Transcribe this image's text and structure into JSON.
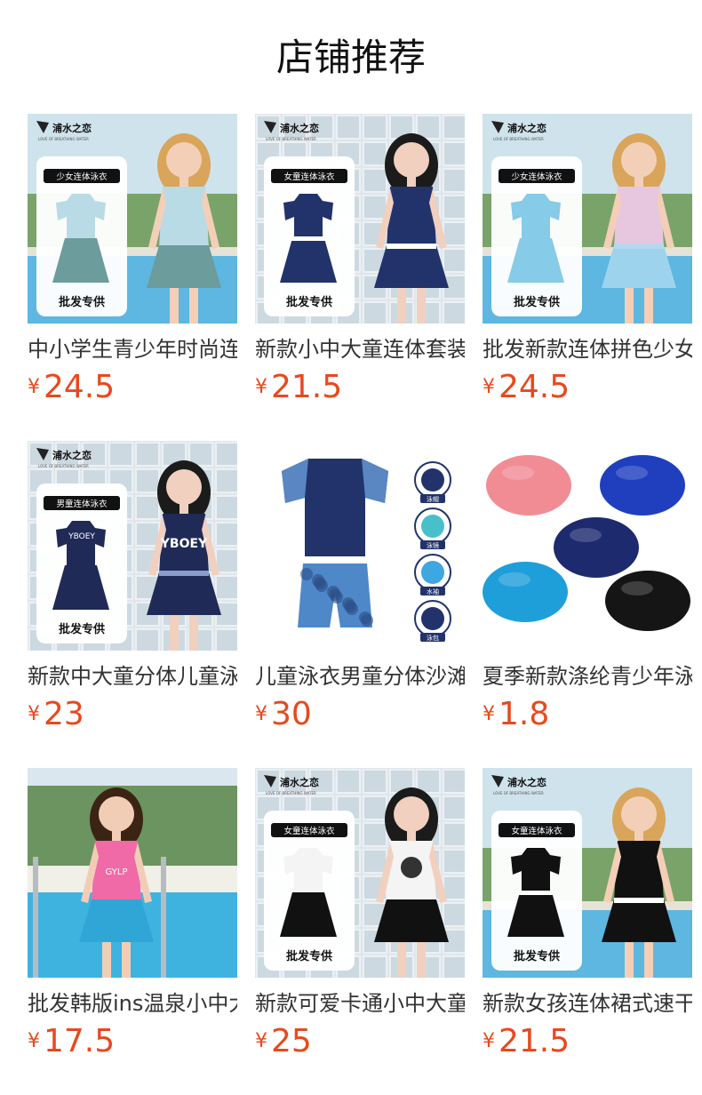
{
  "section_title": "店铺推荐",
  "currency": "¥",
  "badge": {
    "brand": "浦水之恋",
    "brand_sub": "LOVE OF BREATHING WATER",
    "wholesale": "批发专供"
  },
  "products": [
    {
      "name": "中小学生青少年时尚连体泳衣",
      "price": "24.5",
      "tag": "少女连体泳衣",
      "photo": "girl-teal-dress"
    },
    {
      "name": "新款小中大童连体套装泳衣",
      "price": "21.5",
      "tag": "女童连体泳衣",
      "photo": "girl-navy-dress"
    },
    {
      "name": "批发新款连体拼色少女泳衣",
      "price": "24.5",
      "tag": "少女连体泳衣",
      "photo": "girl-blue-dress"
    },
    {
      "name": "新款中大童分体儿童泳衣",
      "price": "23",
      "tag": "男童连体泳衣",
      "photo": "boy-navy-camo"
    },
    {
      "name": "儿童泳衣男童分体沙滩套装",
      "price": "30",
      "tag": "",
      "photo": "boy-camo-set",
      "accessories": [
        "泳帽",
        "泳镜",
        "水袖",
        "泳包"
      ]
    },
    {
      "name": "夏季新款涤纶青少年泳帽",
      "price": "1.8",
      "tag": "",
      "photo": "swim-caps"
    },
    {
      "name": "批发韩版ins温泉小中大童泳衣",
      "price": "17.5",
      "tag": "",
      "photo": "girl-pink-pool"
    },
    {
      "name": "新款可爱卡通小中大童泳衣",
      "price": "25",
      "tag": "女童连体泳衣",
      "photo": "girl-white-black"
    },
    {
      "name": "新款女孩连体裙式速干泳衣",
      "price": "21.5",
      "tag": "女童连体泳衣",
      "photo": "girl-black-ruffle"
    }
  ],
  "colors": {
    "price": "#e8491d",
    "title": "#111111",
    "name": "#333333"
  }
}
